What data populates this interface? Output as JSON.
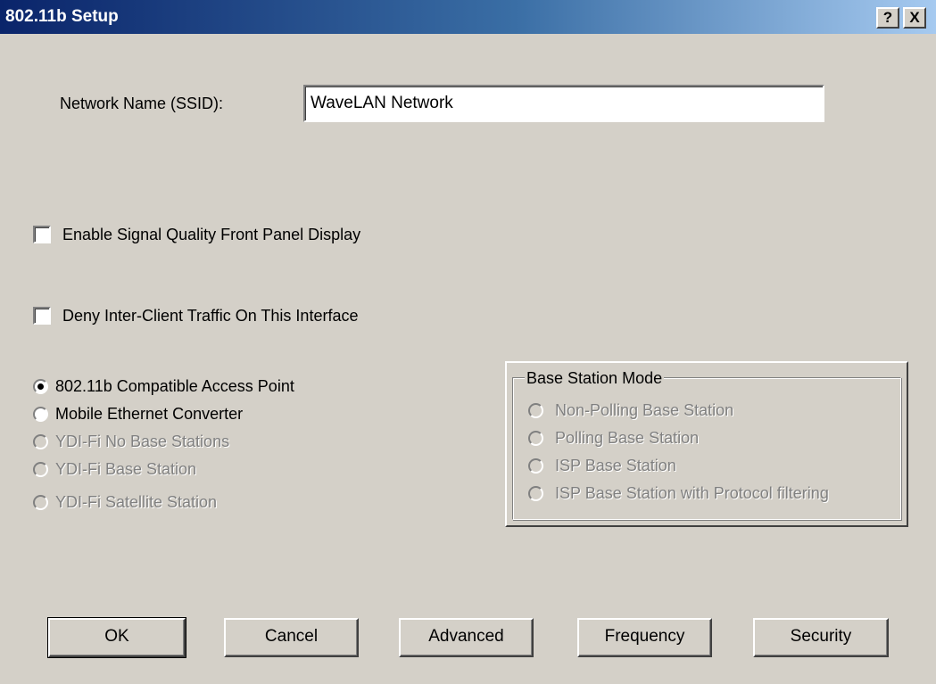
{
  "window": {
    "title": "802.11b Setup",
    "help_label": "?",
    "close_label": "X"
  },
  "ssid": {
    "label": "Network Name (SSID):",
    "value": "WaveLAN Network"
  },
  "checkboxes": [
    {
      "label": "Enable Signal Quality Front Panel Display",
      "checked": false
    },
    {
      "label": "Deny Inter-Client Traffic On This Interface",
      "checked": false
    }
  ],
  "mode_options": [
    {
      "label": "802.11b Compatible Access Point",
      "selected": true,
      "enabled": true
    },
    {
      "label": "Mobile Ethernet Converter",
      "selected": false,
      "enabled": true
    },
    {
      "label": "YDI-Fi No Base Stations",
      "selected": false,
      "enabled": false
    },
    {
      "label": "YDI-Fi Base Station",
      "selected": false,
      "enabled": false
    },
    {
      "label": "YDI-Fi Satellite Station",
      "selected": false,
      "enabled": false
    }
  ],
  "base_station_mode": {
    "legend": "Base Station Mode",
    "options": [
      {
        "label": "Non-Polling Base Station",
        "enabled": false
      },
      {
        "label": "Polling Base Station",
        "enabled": false
      },
      {
        "label": "ISP Base Station",
        "enabled": false
      },
      {
        "label": "ISP Base Station with Protocol filtering",
        "enabled": false
      }
    ]
  },
  "buttons": {
    "ok": "OK",
    "cancel": "Cancel",
    "advanced": "Advanced",
    "frequency": "Frequency",
    "security": "Security"
  },
  "colors": {
    "titlebar_start": "#0a246a",
    "titlebar_end": "#a6caf0",
    "face": "#d4d0c8",
    "disabled_text": "#808080"
  }
}
